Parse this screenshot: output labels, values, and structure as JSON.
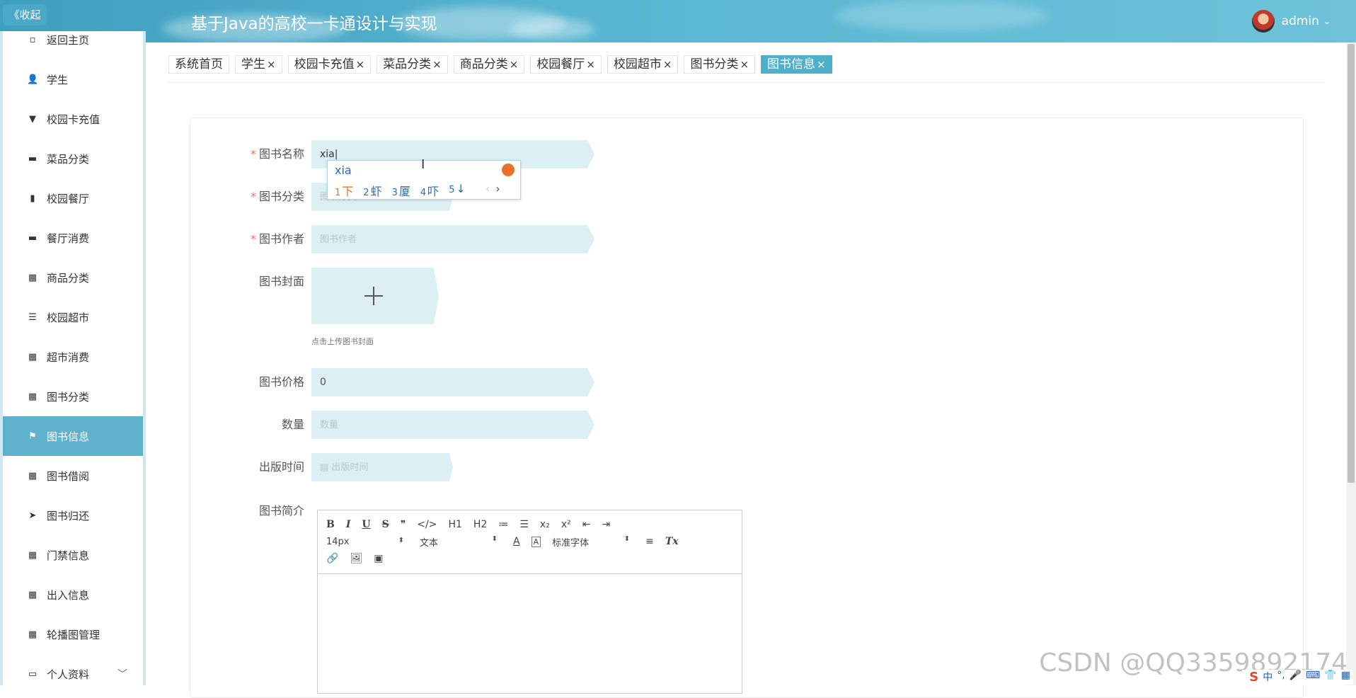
{
  "header": {
    "collapse_label": "《收起",
    "title": "基于Java的高校一卡通设计与实现",
    "user": "admin",
    "caret": "⌄"
  },
  "sidebar": {
    "items": [
      {
        "label": "返回主页",
        "icon": "home-icon",
        "glyph": "▫"
      },
      {
        "label": "学生",
        "icon": "user-icon",
        "glyph": "👤"
      },
      {
        "label": "校园卡充值",
        "icon": "pin-icon",
        "glyph": "▼"
      },
      {
        "label": "菜品分类",
        "icon": "comment-icon",
        "glyph": "▬"
      },
      {
        "label": "校园餐厅",
        "icon": "clipboard-icon",
        "glyph": "▮"
      },
      {
        "label": "餐厅消费",
        "icon": "monitor-icon",
        "glyph": "▬"
      },
      {
        "label": "商品分类",
        "icon": "grid-icon",
        "glyph": "▦"
      },
      {
        "label": "校园超市",
        "icon": "list-icon",
        "glyph": "☰"
      },
      {
        "label": "超市消费",
        "icon": "grid-icon",
        "glyph": "▦"
      },
      {
        "label": "图书分类",
        "icon": "grid-icon",
        "glyph": "▦"
      },
      {
        "label": "图书信息",
        "icon": "flag-icon",
        "glyph": "⚑",
        "active": true
      },
      {
        "label": "图书借阅",
        "icon": "grid-icon",
        "glyph": "▦"
      },
      {
        "label": "图书归还",
        "icon": "send-icon",
        "glyph": "➤"
      },
      {
        "label": "门禁信息",
        "icon": "grid-icon",
        "glyph": "▦"
      },
      {
        "label": "出入信息",
        "icon": "grid-icon",
        "glyph": "▦"
      },
      {
        "label": "轮播图管理",
        "icon": "grid-icon",
        "glyph": "▦"
      },
      {
        "label": "个人资料",
        "icon": "card-icon",
        "glyph": "▭",
        "chevron": "﹀"
      }
    ]
  },
  "tabs": [
    {
      "label": "系统首页",
      "closable": false
    },
    {
      "label": "学生",
      "closable": true
    },
    {
      "label": "校园卡充值",
      "closable": true
    },
    {
      "label": "菜品分类",
      "closable": true
    },
    {
      "label": "商品分类",
      "closable": true
    },
    {
      "label": "校园餐厅",
      "closable": true
    },
    {
      "label": "校园超市",
      "closable": true
    },
    {
      "label": "图书分类",
      "closable": true
    },
    {
      "label": "图书信息",
      "closable": true,
      "active": true
    }
  ],
  "tab_close": "×",
  "form": {
    "required_mark": "*",
    "book_name": {
      "label": "图书名称",
      "value": "xia"
    },
    "book_category": {
      "label": "图书分类",
      "placeholder": "图书分类"
    },
    "book_author": {
      "label": "图书作者",
      "placeholder": "图书作者"
    },
    "book_cover": {
      "label": "图书封面",
      "hint": "点击上传图书封面"
    },
    "book_price": {
      "label": "图书价格",
      "value": "0"
    },
    "quantity": {
      "label": "数量",
      "placeholder": "数量"
    },
    "publish_date": {
      "label": "出版时间",
      "placeholder": "出版时间"
    },
    "summary": {
      "label": "图书简介"
    }
  },
  "ime": {
    "composition": "xia",
    "candidates": [
      {
        "n": "1",
        "text": "下"
      },
      {
        "n": "2",
        "text": "虾"
      },
      {
        "n": "3",
        "text": "厦"
      },
      {
        "n": "4",
        "text": "吓"
      },
      {
        "n": "5",
        "text": "↓"
      }
    ],
    "prev": "‹",
    "next": "›"
  },
  "editor": {
    "row1": [
      "B",
      "I",
      "U",
      "S",
      "❞",
      "</>",
      "H1",
      "H2",
      "≔",
      "☰",
      "x₂",
      "x²",
      "⇤",
      "⇥"
    ],
    "font_size": "14px",
    "text_type": "文本",
    "font_family": "标准字体",
    "row2_tools": [
      "A",
      "A",
      "≡",
      "Tx"
    ],
    "row3": [
      "🔗",
      "🖼",
      "▣"
    ]
  },
  "watermark": "CSDN @QQ3359892174",
  "ime_bar": [
    "S",
    "中",
    "°,",
    "🎤",
    "⌨",
    "👕",
    "▦"
  ]
}
